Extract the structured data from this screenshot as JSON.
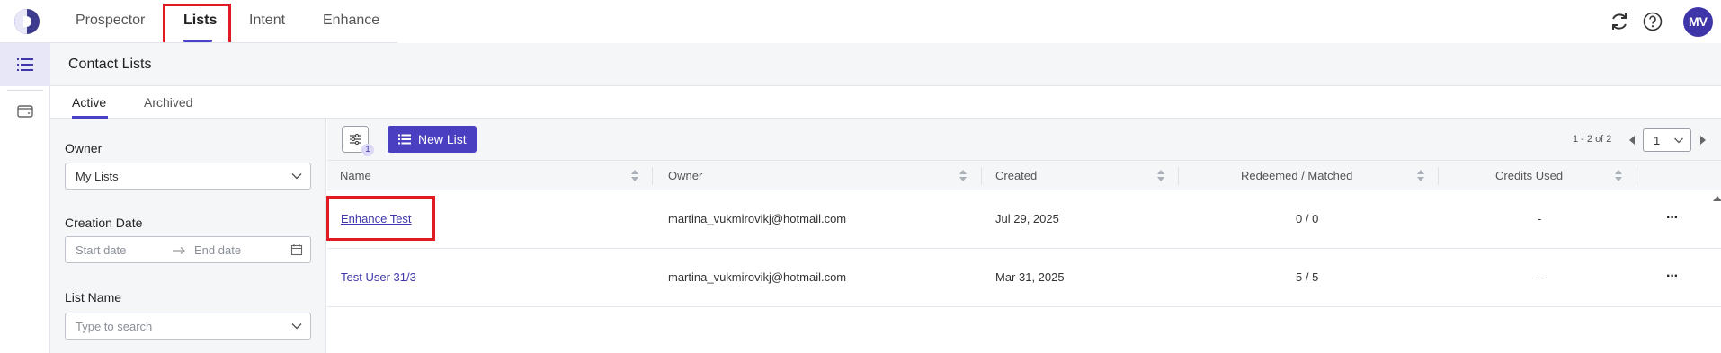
{
  "nav": {
    "tabs": [
      {
        "label": "Prospector"
      },
      {
        "label": "Lists"
      },
      {
        "label": "Intent"
      },
      {
        "label": "Enhance"
      }
    ],
    "user_initials": "MV"
  },
  "page": {
    "title": "Contact Lists",
    "subtabs": [
      {
        "label": "Active"
      },
      {
        "label": "Archived"
      }
    ]
  },
  "filters": {
    "owner_label": "Owner",
    "owner_value": "My Lists",
    "creation_label": "Creation Date",
    "start_placeholder": "Start date",
    "end_placeholder": "End date",
    "list_name_label": "List Name",
    "list_name_placeholder": "Type to search"
  },
  "toolbar": {
    "filter_count": "1",
    "new_list_label": "New List",
    "pager_range": "1 - 2 of 2",
    "page_value": "1"
  },
  "table": {
    "columns": [
      "Name",
      "Owner",
      "Created",
      "Redeemed / Matched",
      "Credits Used"
    ],
    "rows": [
      {
        "name": "Enhance Test",
        "owner": "martina_vukmirovikj@hotmail.com",
        "created": "Jul 29, 2025",
        "redeemed": "0 / 0",
        "credits": "-"
      },
      {
        "name": "Test User 31/3",
        "owner": "martina_vukmirovikj@hotmail.com",
        "created": "Mar 31, 2025",
        "redeemed": "5 / 5",
        "credits": "-"
      }
    ]
  },
  "colors": {
    "accent": "#4b3fc1",
    "highlight": "#e01b24"
  }
}
